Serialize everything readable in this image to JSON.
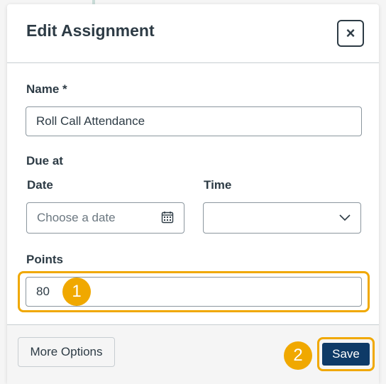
{
  "modal": {
    "title": "Edit Assignment",
    "close_label": "×"
  },
  "form": {
    "name_label": "Name *",
    "name_value": "Roll Call Attendance",
    "due_label": "Due at",
    "date_label": "Date",
    "date_placeholder": "Choose a date",
    "time_label": "Time",
    "time_value": "",
    "points_label": "Points",
    "points_value": "80"
  },
  "footer": {
    "more_options_label": "More Options",
    "save_label": "Save"
  },
  "annotations": {
    "step1": "1",
    "step2": "2"
  },
  "colors": {
    "highlight": "#f0a800",
    "save_button": "#0e3a67",
    "text": "#2d3b45"
  }
}
